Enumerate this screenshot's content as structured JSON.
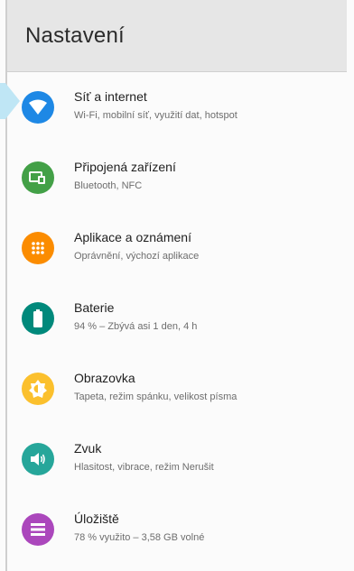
{
  "header": {
    "title": "Nastavení"
  },
  "items": [
    {
      "title": "Síť a internet",
      "subtitle": "Wi-Fi, mobilní síť, využití dat, hotspot",
      "icon": "wifi-icon",
      "color": "#1e88e5"
    },
    {
      "title": "Připojená zařízení",
      "subtitle": "Bluetooth, NFC",
      "icon": "devices-icon",
      "color": "#43a047"
    },
    {
      "title": "Aplikace a oznámení",
      "subtitle": "Oprávnění, výchozí aplikace",
      "icon": "apps-grid-icon",
      "color": "#fb8c00"
    },
    {
      "title": "Baterie",
      "subtitle": "94 % – Zbývá asi 1 den, 4 h",
      "icon": "battery-icon",
      "color": "#00897b"
    },
    {
      "title": "Obrazovka",
      "subtitle": "Tapeta, režim spánku, velikost písma",
      "icon": "brightness-icon",
      "color": "#fbc02d"
    },
    {
      "title": "Zvuk",
      "subtitle": "Hlasitost, vibrace, režim Nerušit",
      "icon": "volume-icon",
      "color": "#26a69a"
    },
    {
      "title": "Úložiště",
      "subtitle": "78 % využito – 3,58 GB volné",
      "icon": "storage-icon",
      "color": "#ab47bc"
    }
  ],
  "accent": {
    "highlight": "#bfe6f5"
  }
}
